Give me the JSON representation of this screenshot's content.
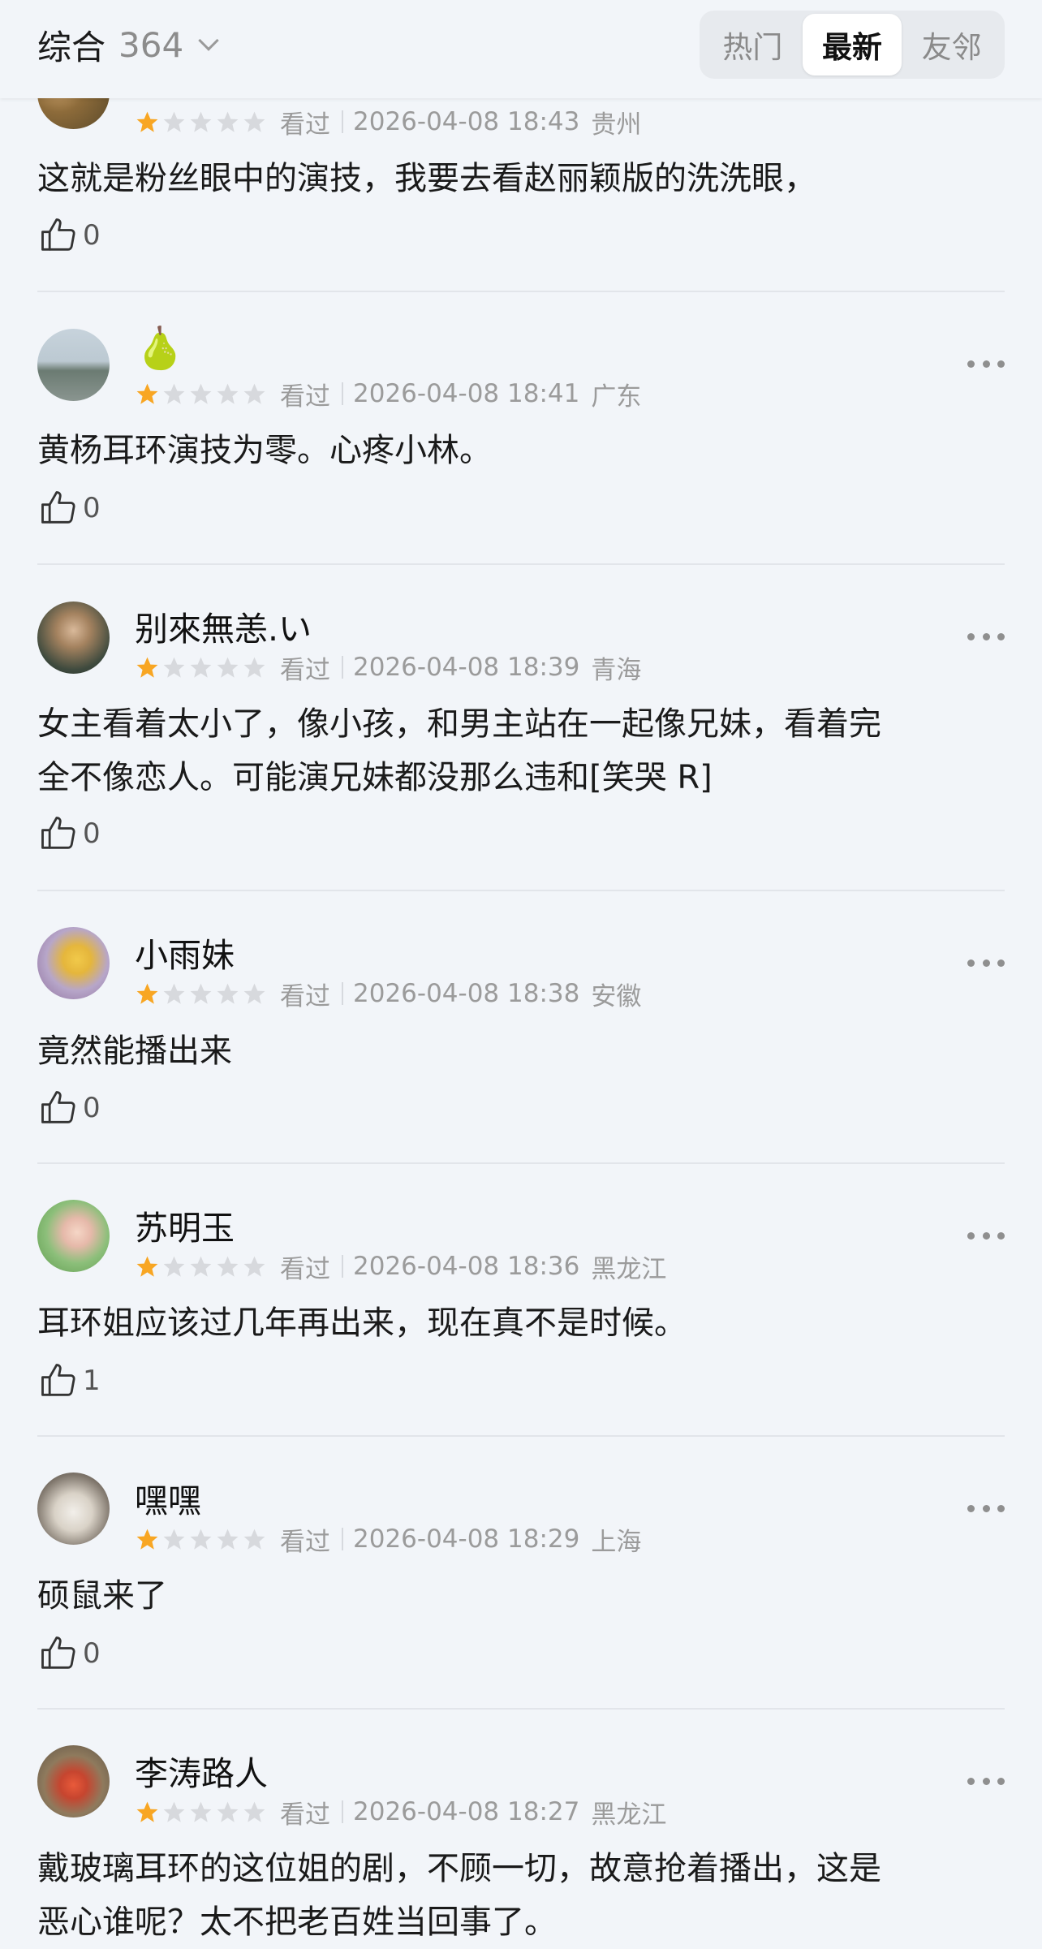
{
  "header": {
    "sort_label": "综合",
    "count": "364",
    "tabs": [
      {
        "label": "热门",
        "active": false
      },
      {
        "label": "最新",
        "active": true
      },
      {
        "label": "友邻",
        "active": false
      }
    ]
  },
  "colors": {
    "star_filled": "#f8a623",
    "star_empty": "#d7d9dd",
    "background": "#f2f5f9"
  },
  "comments": [
    {
      "username": "",
      "rating": 1,
      "status": "看过",
      "datetime": "2026-04-08 18:43",
      "region": "贵州",
      "text": "这就是粉丝眼中的演技，我要去看赵丽颖版的洗洗眼，",
      "likes": "0"
    },
    {
      "username": "🍐",
      "rating": 1,
      "status": "看过",
      "datetime": "2026-04-08 18:41",
      "region": "广东",
      "text": "黄杨耳环演技为零。心疼小林。",
      "likes": "0"
    },
    {
      "username": "别來無恙.い",
      "rating": 1,
      "status": "看过",
      "datetime": "2026-04-08 18:39",
      "region": "青海",
      "text_lines": [
        "女主看着太小了，像小孩，和男主站在一起像兄妹，看着完",
        "全不像恋人。可能演兄妹都没那么违和[笑哭 R]"
      ],
      "likes": "0"
    },
    {
      "username": "小雨妹",
      "rating": 1,
      "status": "看过",
      "datetime": "2026-04-08 18:38",
      "region": "安徽",
      "text": "竟然能播出来",
      "likes": "0"
    },
    {
      "username": "苏明玉",
      "rating": 1,
      "status": "看过",
      "datetime": "2026-04-08 18:36",
      "region": "黑龙江",
      "text": "耳环姐应该过几年再出来，现在真不是时候。",
      "likes": "1"
    },
    {
      "username": "嘿嘿",
      "rating": 1,
      "status": "看过",
      "datetime": "2026-04-08 18:29",
      "region": "上海",
      "text": "硕鼠来了",
      "likes": "0"
    },
    {
      "username": "李涛路人",
      "rating": 1,
      "status": "看过",
      "datetime": "2026-04-08 18:27",
      "region": "黑龙江",
      "text_lines": [
        "戴玻璃耳环的这位姐的剧，不顾一切，故意抢着播出，这是",
        "恶心谁呢？太不把老百姓当回事了。"
      ],
      "likes": ""
    }
  ]
}
